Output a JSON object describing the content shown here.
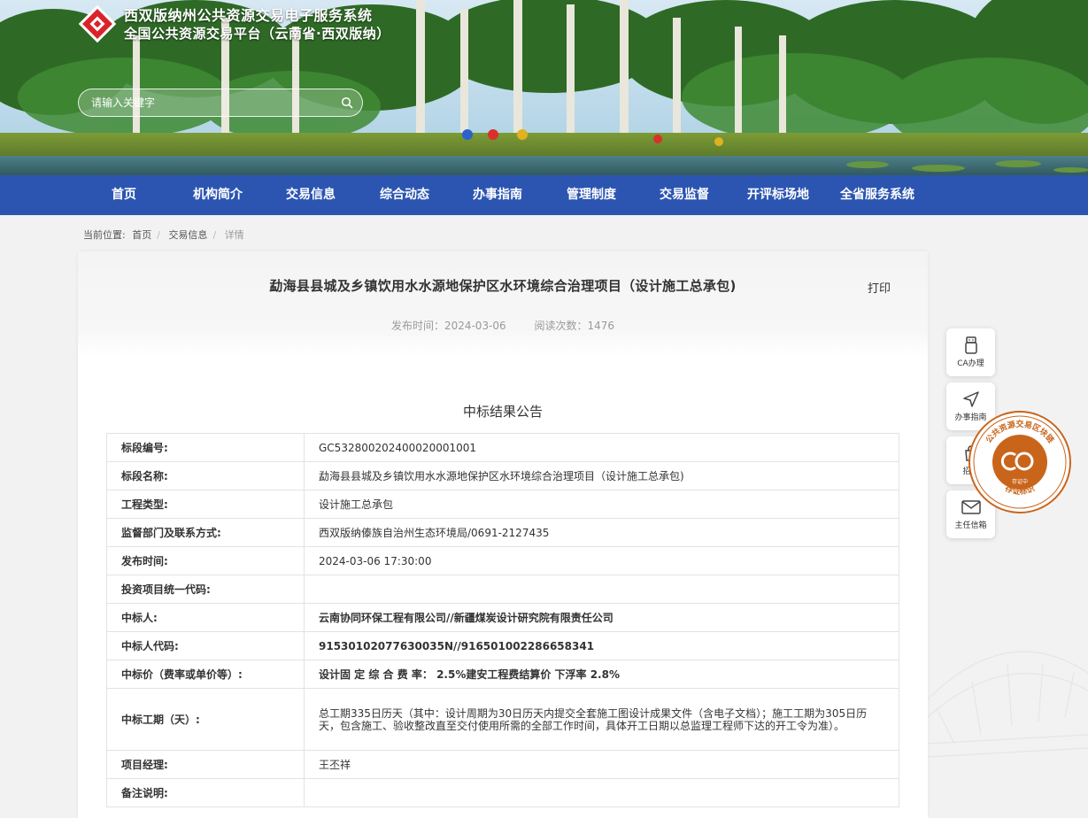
{
  "header": {
    "site_title": "西双版纳州公共资源交易电子服务系统",
    "site_subtitle": "全国公共资源交易平台（云南省·西双版纳）",
    "search_placeholder": "请输入关键字"
  },
  "nav": [
    "首页",
    "机构简介",
    "交易信息",
    "综合动态",
    "办事指南",
    "管理制度",
    "交易监督",
    "开评标场地",
    "全省服务系统"
  ],
  "breadcrumb": {
    "prefix": "当前位置:",
    "items": [
      "首页",
      "交易信息"
    ],
    "current": "详情"
  },
  "article": {
    "title": "勐海县县城及乡镇饮用水水源地保护区水环境综合治理项目（设计施工总承包)",
    "print_label": "打印",
    "publish_time": "发布时间：2024-03-06",
    "read_count": "阅读次数：1476",
    "notice_title": "中标结果公告"
  },
  "table": [
    {
      "key": "标段编号:",
      "value": "GC5328002024000200​01001"
    },
    {
      "key": "标段名称:",
      "value": "勐海县县城及乡镇饮用水水源地保护区水环境综合治理项目（设计施工总承包)"
    },
    {
      "key": "工程类型:",
      "value": "设计施工总承包"
    },
    {
      "key": "监督部门及联系方式:",
      "value": "西双版纳傣族自治州生态环境局/0691-2127435"
    },
    {
      "key": "发布时间:",
      "value": "2024-03-06 17:30:00"
    },
    {
      "key": "投资项目统一代码:",
      "value": ""
    },
    {
      "key": "中标人:",
      "value": "云南协同环保工程有限公司//新疆煤炭设计研究院有限责任公司"
    },
    {
      "key": "中标人代码:",
      "value": "91530102077630035N//916501002286658341"
    },
    {
      "key": "中标价（费率或单价等）:",
      "value": "设计固 定 综 合 费 率： 2.5%建安工程费结算价 下浮率 2.8%"
    },
    {
      "key": "中标工期（天）:",
      "value": "总工期335日历天（其中：设计周期为30日历天内提交全套施工图设计成果文件（含电子文档）；施工工期为305日历天，包含施工、验收整改直至交付使用所需的全部工作时间，具体开工日期以总监理工程师下达的开工令为准）。"
    },
    {
      "key": "项目经理:",
      "value": "王丕祥"
    },
    {
      "key": "备注说明:",
      "value": ""
    }
  ],
  "side_tools": [
    "CA办理",
    "办事指南",
    "招采",
    "主任信箱"
  ],
  "stamp": {
    "top_text": "公共资源交易区块链",
    "center": "存证中",
    "bottom_text": "存证标识"
  },
  "colors": {
    "nav_bg": "#2c55b1",
    "logo_red": "#d9232a",
    "stamp_orange": "#c9651b"
  }
}
